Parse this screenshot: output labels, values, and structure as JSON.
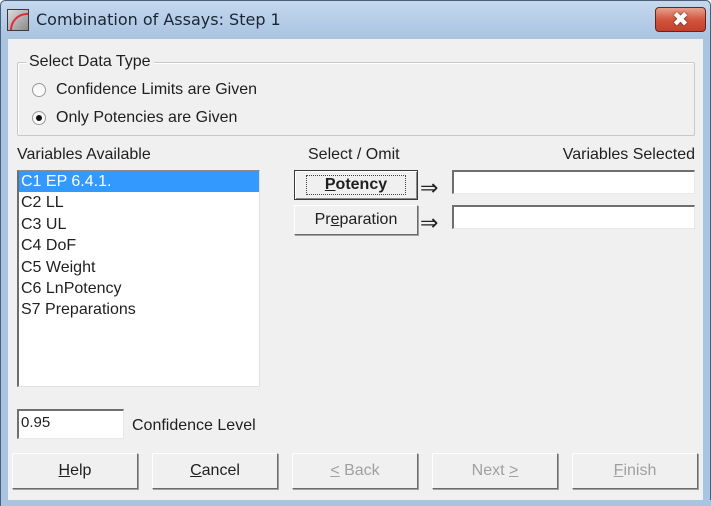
{
  "window": {
    "title": "Combination of Assays: Step 1",
    "close_glyph": "✖"
  },
  "data_type": {
    "group_label": "Select Data Type",
    "options": [
      {
        "label": "Confidence Limits are Given",
        "checked": false
      },
      {
        "label": "Only Potencies are Given",
        "checked": true
      }
    ]
  },
  "variables_available": {
    "label": "Variables Available",
    "items": [
      {
        "label": "C1 EP 6.4.1.",
        "selected": true
      },
      {
        "label": "C2 LL",
        "selected": false
      },
      {
        "label": "C3 UL",
        "selected": false
      },
      {
        "label": "C4 DoF",
        "selected": false
      },
      {
        "label": "C5 Weight",
        "selected": false
      },
      {
        "label": "C6 LnPotency",
        "selected": false
      },
      {
        "label": "S7 Preparations",
        "selected": false
      }
    ]
  },
  "select_omit": {
    "label": "Select / Omit",
    "potency_button": {
      "prefix": "",
      "underline": "P",
      "suffix": "otency"
    },
    "preparation_button": {
      "prefix": "Pr",
      "underline": "e",
      "suffix": "paration"
    },
    "arrow_glyph": "⇒"
  },
  "variables_selected": {
    "label": "Variables Selected",
    "potency_value": "",
    "preparation_value": ""
  },
  "confidence": {
    "value": "0.95",
    "label": "Confidence Level"
  },
  "footer": {
    "help": {
      "underline": "H",
      "suffix": "elp"
    },
    "cancel": {
      "underline": "C",
      "suffix": "ancel"
    },
    "back": {
      "underline": "<",
      "suffix": " Back"
    },
    "next": {
      "prefix": "Next ",
      "underline": ">"
    },
    "finish": {
      "underline": "F",
      "suffix": "inish"
    }
  }
}
